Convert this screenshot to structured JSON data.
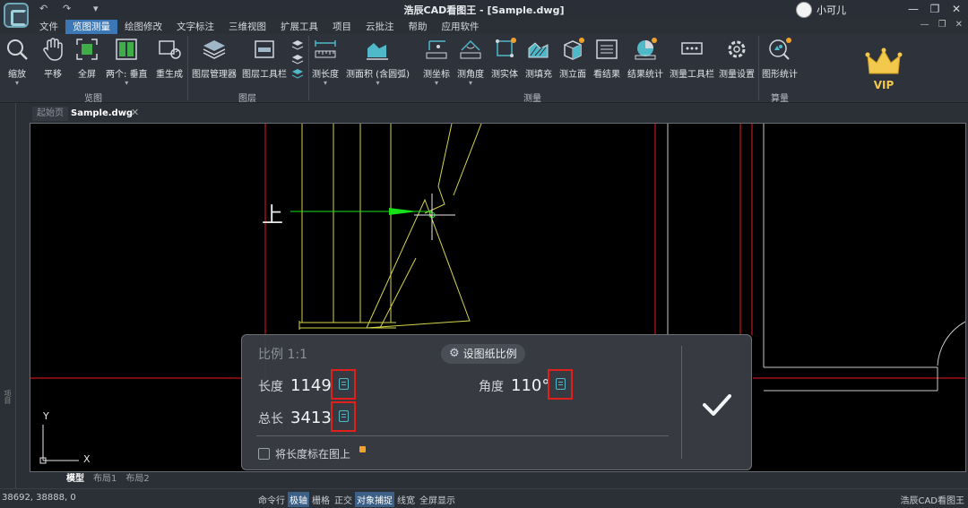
{
  "app": {
    "title": "浩辰CAD看图王 - [Sample.dwg]",
    "quick_access": [
      "↶",
      "↷",
      "▾"
    ],
    "user_name": "小可儿"
  },
  "menu": [
    "文件",
    "览图测量",
    "绘图修改",
    "文字标注",
    "三维视图",
    "扩展工具",
    "项目",
    "云批注",
    "帮助",
    "应用软件"
  ],
  "menu_active": "览图测量",
  "ribbon": {
    "browse": {
      "label": "览图",
      "buttons": [
        "缩放",
        "平移",
        "全屏",
        "两个:",
        "垂直",
        "重生成"
      ]
    },
    "layer": {
      "label": "图层",
      "buttons": [
        "图层管理器",
        "图层工具栏"
      ]
    },
    "measure": {
      "label": "测量",
      "buttons": [
        "测长度",
        "测面积 (含圆弧)",
        "测坐标",
        "测角度",
        "测实体",
        "测填充",
        "测立面",
        "看结果",
        "结果统计",
        "测量工具栏",
        "测量设置"
      ]
    },
    "calc": {
      "label": "算量",
      "buttons": [
        "图形统计"
      ]
    },
    "vip": "VIP"
  },
  "tabs": {
    "start": "起始页",
    "document": "Sample.dwg",
    "close_glyph": "✕"
  },
  "sidebar_text": "项目",
  "canvas": {
    "text_shang": "上",
    "axis_y": "Y",
    "axis_x": "X"
  },
  "layout_tabs": [
    "模型",
    "布局1",
    "布局2"
  ],
  "status": {
    "coords": "38692, 38888, 0",
    "toggles": [
      {
        "label": "命令行",
        "on": false
      },
      {
        "label": "极轴",
        "on": true
      },
      {
        "label": "栅格",
        "on": false
      },
      {
        "label": "正交",
        "on": false
      },
      {
        "label": "对象捕捉",
        "on": true
      },
      {
        "label": "线宽",
        "on": false
      },
      {
        "label": "全屏显示",
        "on": false
      }
    ],
    "brand": "浩辰CAD看图王"
  },
  "measure_panel": {
    "scale_label": "比例 1:1",
    "set_scale_button": "设图纸比例",
    "length_label": "长度",
    "length_value": "1149",
    "total_label": "总长",
    "total_value": "3413",
    "angle_label": "角度",
    "angle_value": "110°",
    "mark_length_label": "将长度标在图上",
    "mark_length_checked": false
  },
  "colors": {
    "accent": "#3c78b5",
    "highlight_box": "#e0201a",
    "drawing_red": "#c0141c",
    "drawing_yellow": "#d4d44a",
    "measure_green": "#18e018"
  }
}
